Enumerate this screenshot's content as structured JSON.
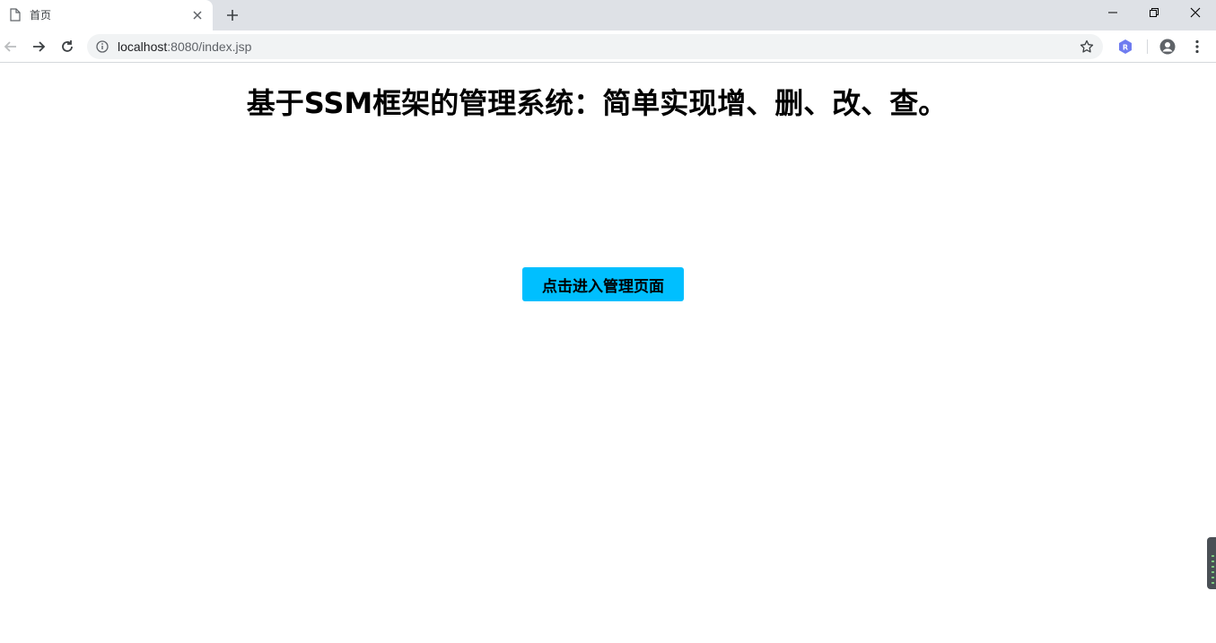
{
  "browser": {
    "tab": {
      "title": "首页"
    },
    "address_bar": {
      "url_host": "localhost",
      "url_rest": ":8080/index.jsp"
    },
    "extension_label": "R",
    "colors": {
      "tabstrip": "#dee1e6",
      "omnibox": "#f1f3f4",
      "extension": "#6f7cf0"
    }
  },
  "page": {
    "title": "基于SSM框架的管理系统：简单实现增、删、改、查。",
    "enter_button_label": "点击进入管理页面",
    "colors": {
      "button_bg": "#00bfff",
      "background": "#ffffff"
    }
  }
}
